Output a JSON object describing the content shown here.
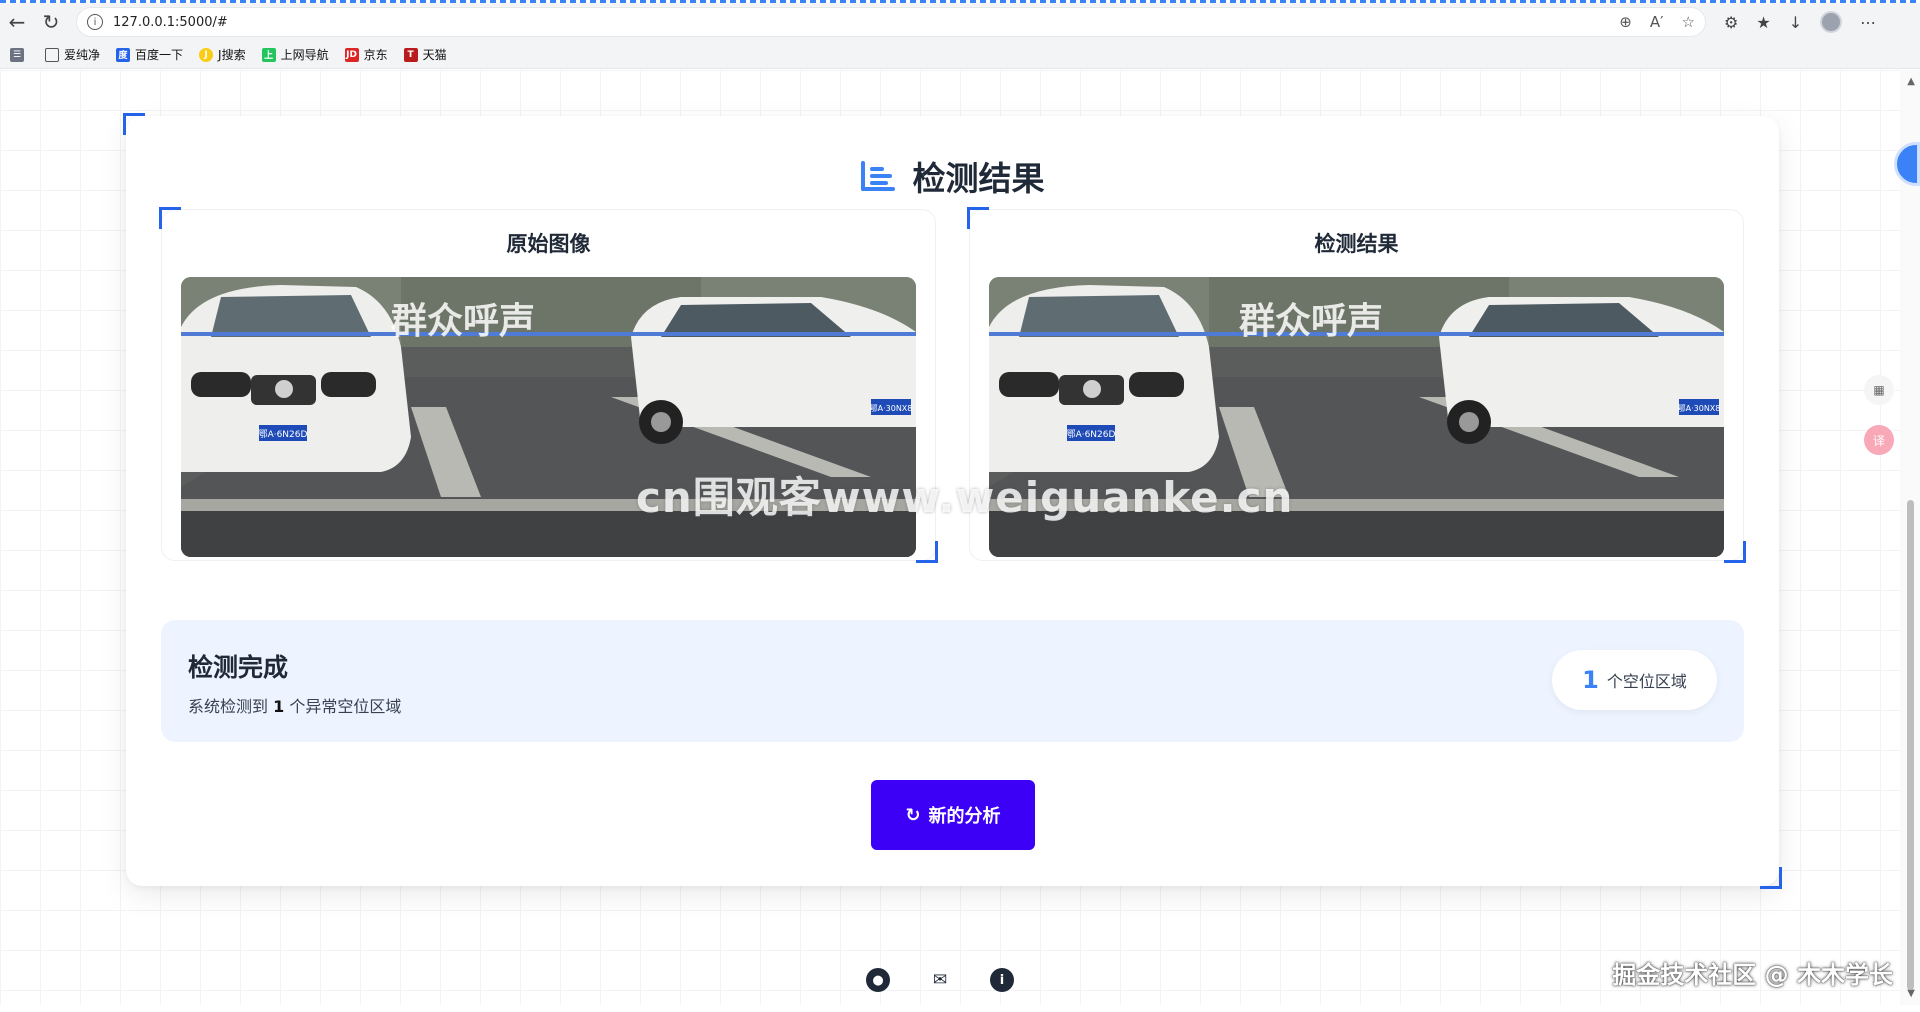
{
  "browser": {
    "url": "127.0.0.1:5000/#",
    "bookmarks": [
      "爱纯净",
      "百度一下",
      "J搜索",
      "上网导航",
      "京东",
      "天猫"
    ]
  },
  "result": {
    "title": "检测结果",
    "original_panel_title": "原始图像",
    "result_panel_title": "检测结果",
    "image_caption_overlay": "群众呼声",
    "plate_left": "鄂A·6N26D",
    "plate_right": "鄂A·30NX8",
    "status_title": "检测完成",
    "status_sub_prefix": "系统检测到",
    "status_count": "1",
    "status_sub_suffix": "个异常空位区域",
    "pill_count": "1",
    "pill_label": "个空位区域",
    "new_button_label": "新的分析"
  },
  "overlays": {
    "watermark": "cn围观客www.weiguanke.cn",
    "credit": "掘金技术社区 @ 木木学长"
  },
  "colors": {
    "accent": "#3b82f6",
    "button": "#3b00f5",
    "status_bg": "#eef4ff"
  }
}
